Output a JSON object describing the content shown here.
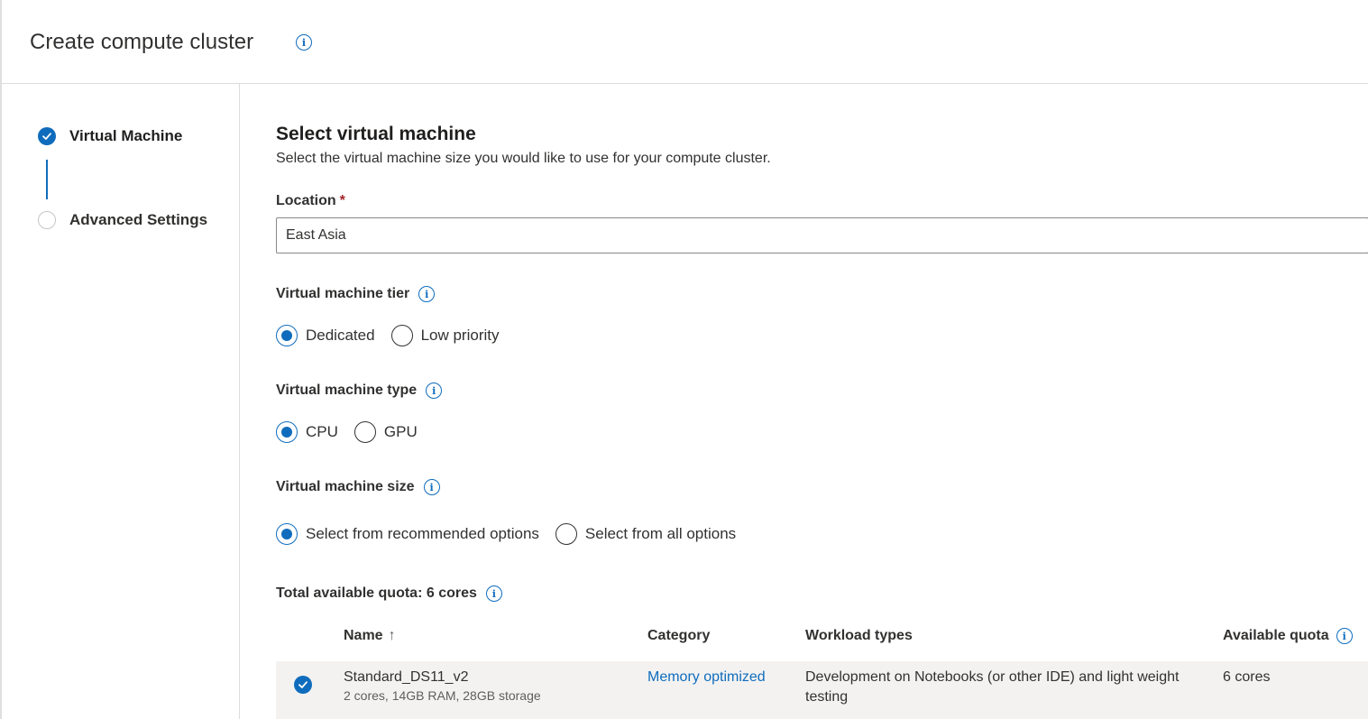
{
  "header": {
    "title": "Create compute cluster"
  },
  "steps": [
    {
      "label": "Virtual Machine",
      "state": "complete"
    },
    {
      "label": "Advanced Settings",
      "state": "pending"
    }
  ],
  "main": {
    "title": "Select virtual machine",
    "subtitle": "Select the virtual machine size you would like to use for your compute cluster.",
    "location": {
      "label": "Location",
      "required_mark": "*",
      "value": "East Asia"
    },
    "tier": {
      "label": "Virtual machine tier",
      "options": [
        "Dedicated",
        "Low priority"
      ],
      "selected": "Dedicated"
    },
    "type": {
      "label": "Virtual machine type",
      "options": [
        "CPU",
        "GPU"
      ],
      "selected": "CPU"
    },
    "size": {
      "label": "Virtual machine size",
      "options": [
        "Select from recommended options",
        "Select from all options"
      ],
      "selected": "Select from recommended options"
    },
    "quota": {
      "label": "Total available quota: 6 cores"
    }
  },
  "table": {
    "columns": [
      "Name",
      "Category",
      "Workload types",
      "Available quota"
    ],
    "sort_icon": "↑",
    "rows": [
      {
        "selected": true,
        "name": "Standard_DS11_v2",
        "specs": "2 cores, 14GB RAM, 28GB storage",
        "category": "Memory optimized",
        "workload": "Development on Notebooks (or other IDE) and light weight testing",
        "quota": "6 cores"
      }
    ]
  },
  "colors": {
    "accent": "#0f6cbd",
    "required": "#a4262c",
    "row_selected_bg": "#f3f2f1"
  }
}
